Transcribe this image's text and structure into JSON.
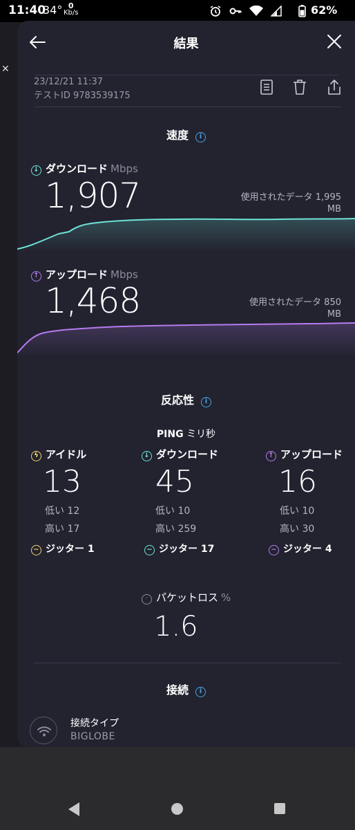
{
  "status_bar": {
    "time": "11:40",
    "temp": "34°",
    "net_speed_value": "0",
    "net_speed_unit": "Kb/s",
    "battery": "62%"
  },
  "header": {
    "title": "結果"
  },
  "meta": {
    "datetime": "23/12/21 11:37",
    "test_id": "テストID 9783539175"
  },
  "speed_section": {
    "title": "速度",
    "download": {
      "label": "ダウンロード",
      "unit": "Mbps",
      "value": "1,907",
      "data_used_label": "使用されたデータ 1,995",
      "data_used_unit": "MB"
    },
    "upload": {
      "label": "アップロード",
      "unit": "Mbps",
      "value": "1,468",
      "data_used_label": "使用されたデータ 850",
      "data_used_unit": "MB"
    }
  },
  "responsiveness": {
    "title": "反応性",
    "ping_title": "PING",
    "ping_unit": "ミリ秒",
    "idle": {
      "label": "アイドル",
      "value": "13",
      "low": "低い 12",
      "high": "高い 17",
      "jitter": "ジッター 1"
    },
    "download": {
      "label": "ダウンロード",
      "value": "45",
      "low": "低い 10",
      "high": "高い 259",
      "jitter": "ジッター 17"
    },
    "upload": {
      "label": "アップロード",
      "value": "16",
      "low": "低い 10",
      "high": "高い 30",
      "jitter": "ジッター 4"
    },
    "packet_loss": {
      "label": "パケットロス",
      "unit": "%",
      "value": "1.6"
    }
  },
  "connection": {
    "title": "接続",
    "type_label": "接続タイプ",
    "isp": "BIGLOBE"
  },
  "colors": {
    "background": "#22232f",
    "download_accent": "#6fe3d8",
    "upload_accent": "#b67bf0",
    "idle_accent": "#f3d36b",
    "info_blue": "#4aa3e8"
  }
}
